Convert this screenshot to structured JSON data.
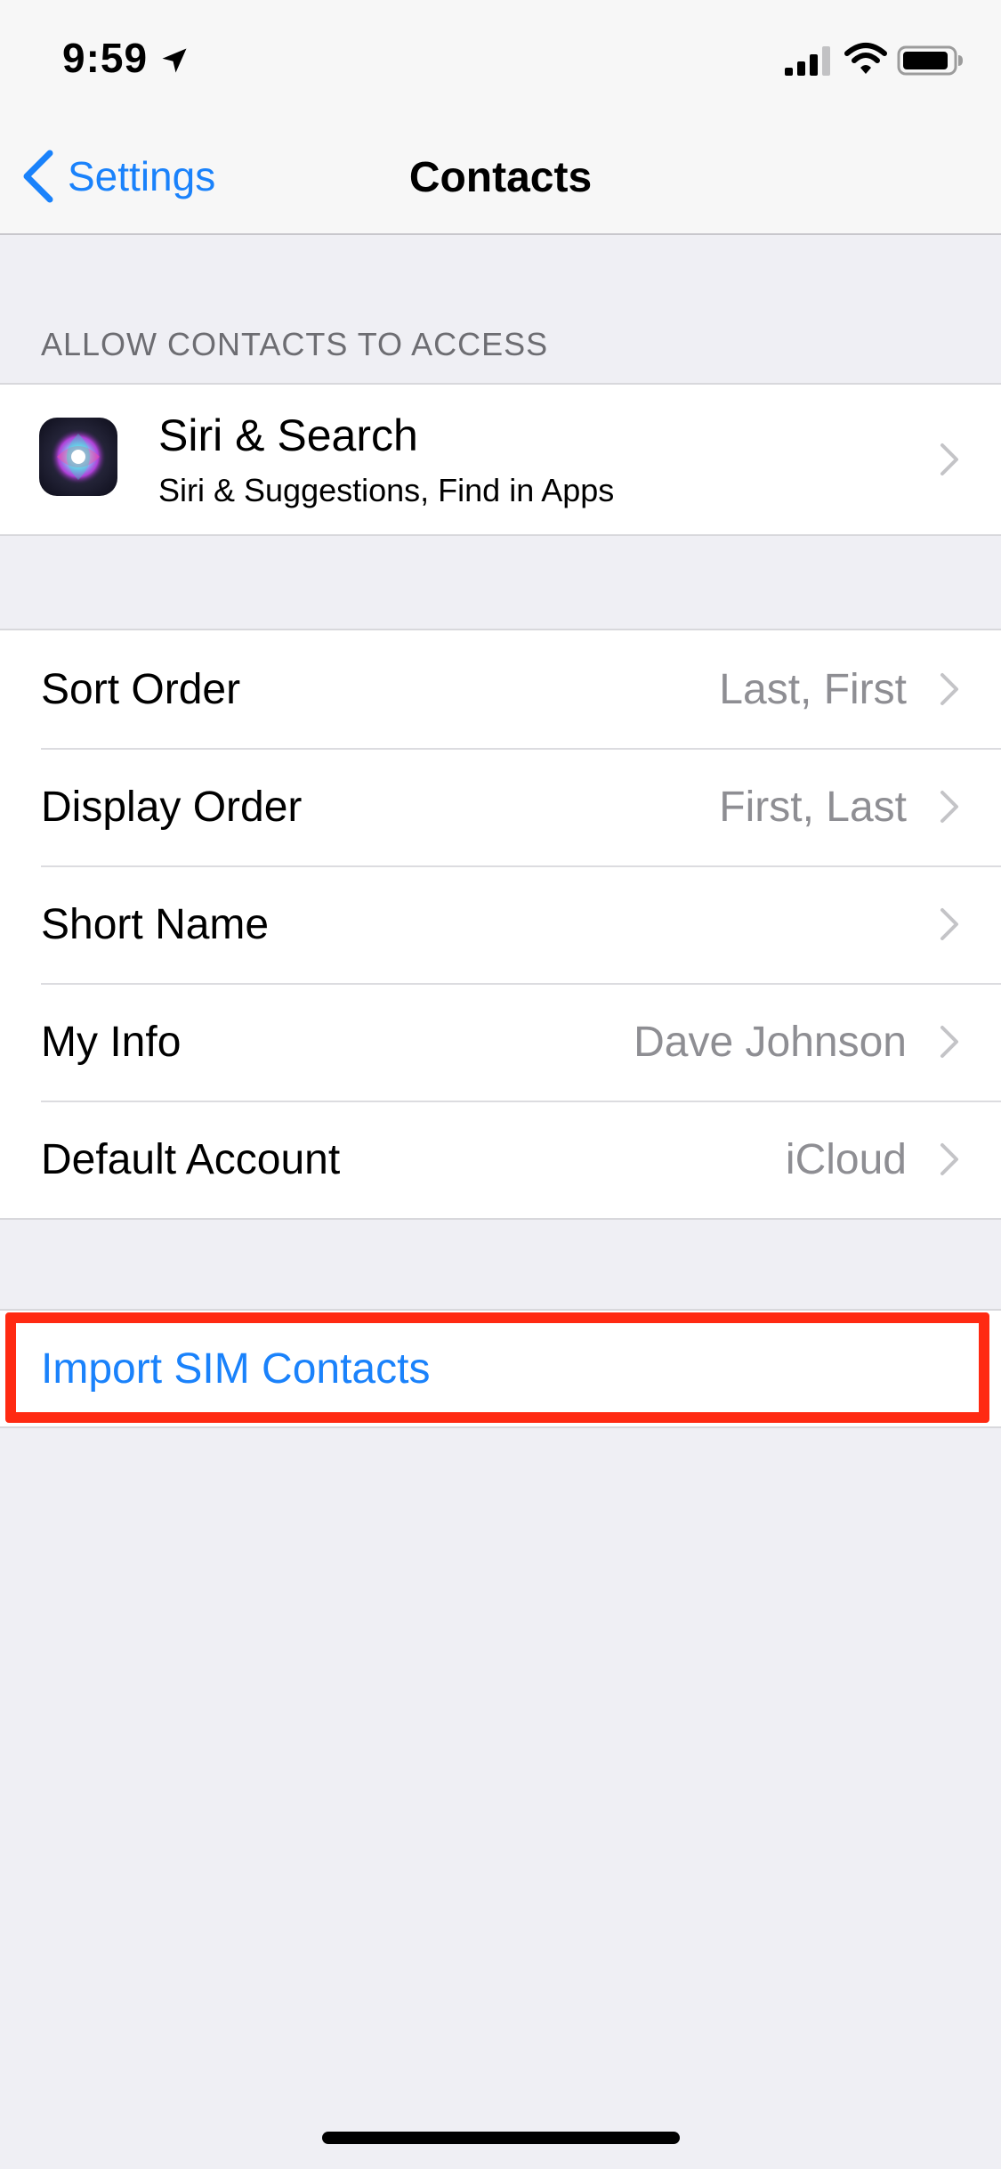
{
  "status_bar": {
    "time": "9:59"
  },
  "nav": {
    "back_label": "Settings",
    "title": "Contacts"
  },
  "section_header": "ALLOW CONTACTS TO ACCESS",
  "siri_row": {
    "title": "Siri & Search",
    "subtitle": "Siri & Suggestions, Find in Apps"
  },
  "settings": {
    "sort_order": {
      "label": "Sort Order",
      "value": "Last, First"
    },
    "display_order": {
      "label": "Display Order",
      "value": "First, Last"
    },
    "short_name": {
      "label": "Short Name",
      "value": ""
    },
    "my_info": {
      "label": "My Info",
      "value": "Dave Johnson"
    },
    "default_account": {
      "label": "Default Account",
      "value": "iCloud"
    }
  },
  "import_sim": {
    "label": "Import SIM Contacts"
  },
  "colors": {
    "accent": "#1a82fb",
    "highlight": "#ff2a12",
    "background": "#efeff4",
    "secondary_text": "#8e8e93"
  },
  "icons": {
    "location": "location-arrow-icon",
    "signal": "cellular-signal-icon",
    "wifi": "wifi-icon",
    "battery": "battery-icon",
    "back": "chevron-left-icon",
    "siri": "siri-icon",
    "disclosure": "chevron-right-icon"
  }
}
